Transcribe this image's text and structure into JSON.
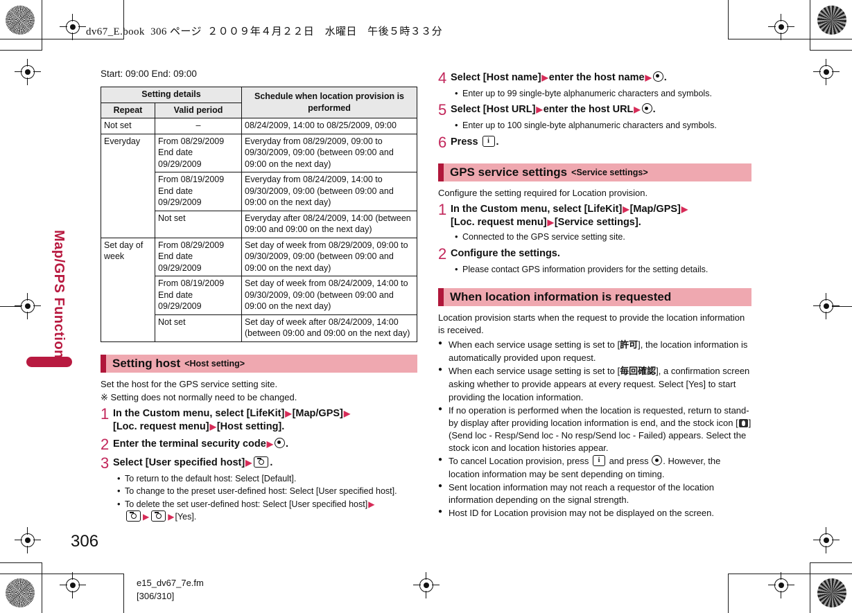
{
  "print_marks": {
    "header_line": "dv67_E.book  306 ページ  ２００９年４月２２日　水曜日　午後５時３３分"
  },
  "side_tab": {
    "label": "Map/GPS Function",
    "color": "#b81a40"
  },
  "left_column": {
    "lead_line": "Start: 09:00 End: 09:00",
    "table": {
      "group_headers": [
        "Setting details",
        "Schedule when location provision is performed"
      ],
      "sub_headers": [
        "Repeat",
        "Valid period"
      ],
      "rows": [
        {
          "repeat": "Not set",
          "repeat_rowspan": 1,
          "period": "–",
          "period_center": true,
          "schedule": "08/24/2009, 14:00 to 08/25/2009, 09:00"
        },
        {
          "repeat": "Everyday",
          "repeat_rowspan": 3,
          "period": "From 08/29/2009\nEnd date 09/29/2009",
          "schedule": "Everyday from 08/29/2009, 09:00 to 09/30/2009, 09:00 (between 09:00 and 09:00 on the next day)"
        },
        {
          "period": "From 08/19/2009\nEnd date 09/29/2009",
          "schedule": "Everyday from 08/24/2009, 14:00 to 09/30/2009, 09:00 (between 09:00 and 09:00 on the next day)"
        },
        {
          "period": "Not set",
          "schedule": "Everyday after 08/24/2009, 14:00 (between 09:00 and 09:00 on the next day)"
        },
        {
          "repeat": "Set day of week",
          "repeat_rowspan": 3,
          "period": "From 08/29/2009\nEnd date 09/29/2009",
          "schedule": "Set day of week from 08/29/2009, 09:00 to 09/30/2009, 09:00 (between 09:00 and 09:00 on the next day)"
        },
        {
          "period": "From 08/19/2009\nEnd date 09/29/2009",
          "schedule": "Set day of week from 08/24/2009, 14:00 to 09/30/2009, 09:00 (between 09:00 and 09:00 on the next day)"
        },
        {
          "period": "Not set",
          "schedule": "Set day of week after 08/24/2009, 14:00 (between 09:00 and 09:00 on the next day)"
        }
      ]
    },
    "section": {
      "title": "Setting host",
      "subtitle": "<Host setting>",
      "intro_1": "Set the host for the GPS service setting site.",
      "intro_2": "※ Setting does not normally need to be changed.",
      "steps": [
        {
          "num": "1",
          "parts": [
            {
              "t": "text",
              "v": "In the Custom menu, select [LifeKit]"
            },
            {
              "t": "arrow"
            },
            {
              "t": "text",
              "v": "[Map/GPS]"
            },
            {
              "t": "arrow"
            },
            {
              "t": "text",
              "v": "[Loc. request menu]"
            },
            {
              "t": "arrow"
            },
            {
              "t": "text",
              "v": "[Host setting]."
            }
          ],
          "bullets": []
        },
        {
          "num": "2",
          "parts": [
            {
              "t": "text",
              "v": "Enter the terminal security code"
            },
            {
              "t": "arrow"
            },
            {
              "t": "key-round"
            },
            {
              "t": "text",
              "v": "."
            }
          ],
          "bullets": []
        },
        {
          "num": "3",
          "parts": [
            {
              "t": "text",
              "v": "Select [User specified host]"
            },
            {
              "t": "arrow"
            },
            {
              "t": "key-cam"
            },
            {
              "t": "text",
              "v": "."
            }
          ],
          "bullets": [
            "To return to the default host: Select [Default].",
            "To change to the preset user-defined host: Select [User specified host].",
            "To delete the set user-defined host: Select [User specified host] ▶ (camera) ▶ (camera) ▶ [Yes]."
          ]
        }
      ]
    }
  },
  "right_column": {
    "steps_continued": [
      {
        "num": "4",
        "parts": [
          {
            "t": "text",
            "v": "Select [Host name]"
          },
          {
            "t": "arrow"
          },
          {
            "t": "text",
            "v": "enter the host name"
          },
          {
            "t": "arrow"
          },
          {
            "t": "key-round"
          },
          {
            "t": "text",
            "v": "."
          }
        ],
        "bullets": [
          "Enter up to 99 single-byte alphanumeric characters and symbols."
        ]
      },
      {
        "num": "5",
        "parts": [
          {
            "t": "text",
            "v": "Select [Host URL]"
          },
          {
            "t": "arrow"
          },
          {
            "t": "text",
            "v": "enter the host URL"
          },
          {
            "t": "arrow"
          },
          {
            "t": "key-round"
          },
          {
            "t": "text",
            "v": "."
          }
        ],
        "bullets": [
          "Enter up to 100 single-byte alphanumeric characters and symbols."
        ]
      },
      {
        "num": "6",
        "parts": [
          {
            "t": "text",
            "v": "Press"
          },
          {
            "t": "key-i"
          },
          {
            "t": "text",
            "v": "."
          }
        ],
        "bullets": []
      }
    ],
    "section_gps": {
      "title": "GPS service settings",
      "subtitle": "<Service settings>",
      "intro": "Configure the setting required for Location provision.",
      "steps": [
        {
          "num": "1",
          "parts": [
            {
              "t": "text",
              "v": "In the Custom menu, select [LifeKit]"
            },
            {
              "t": "arrow"
            },
            {
              "t": "text",
              "v": "[Map/GPS]"
            },
            {
              "t": "arrow"
            },
            {
              "t": "text",
              "v": "[Loc. request menu]"
            },
            {
              "t": "arrow"
            },
            {
              "t": "text",
              "v": "[Service settings]."
            }
          ],
          "bullets": [
            "Connected to the GPS service setting site."
          ]
        },
        {
          "num": "2",
          "parts": [
            {
              "t": "text",
              "v": "Configure the settings."
            }
          ],
          "bullets": [
            "Please contact GPS information providers for the setting details."
          ]
        }
      ]
    },
    "section_request": {
      "title": "When location information is requested",
      "intro": "Location provision starts when the request to provide the location information is received.",
      "notes": [
        "When each service usage setting is set to [許可], the location information is automatically provided upon request.",
        "When each service usage setting is set to [毎回確認], a confirmation screen asking whether to provide appears at every request. Select [Yes] to start providing the location information.",
        "If no operation is performed when the location is requested, return to stand-by display after providing location information is end, and the stock icon [ ] (Send loc - Resp/Send loc - No resp/Send loc - Failed) appears. Select the stock icon and location histories appear.",
        "To cancel Location provision, press ( i ) and press ( • ). However, the location information may be sent depending on timing.",
        "Sent location information may not reach a requestor of the location information depending on the signal strength.",
        "Host ID for Location provision may not be displayed on the screen."
      ]
    }
  },
  "footer": {
    "page_number": "306",
    "file_name": "e15_dv67_7e.fm",
    "page_range": "[306/310]"
  }
}
